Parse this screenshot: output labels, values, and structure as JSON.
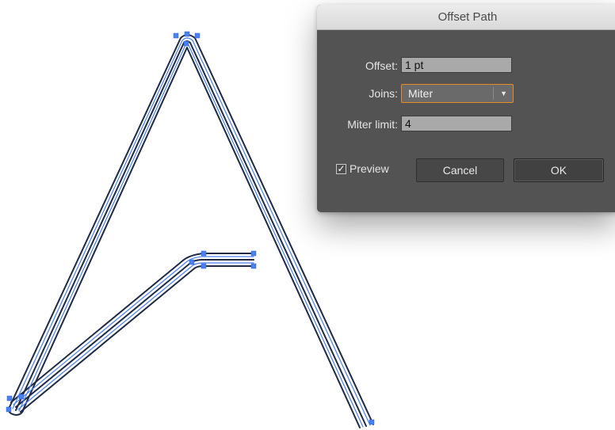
{
  "dialog": {
    "title": "Offset Path",
    "offset": {
      "label": "Offset:",
      "value": "1 pt"
    },
    "joins": {
      "label": "Joins:",
      "selected": "Miter",
      "arrow": "▼"
    },
    "miter_limit": {
      "label": "Miter limit:",
      "value": "4"
    },
    "preview": {
      "label": "Preview",
      "checked": true,
      "check_glyph": "✓"
    },
    "cancel_label": "Cancel",
    "ok_label": "OK"
  },
  "colors": {
    "dialog_bg": "#535353",
    "titlebar": "#dcdcdc",
    "focus_accent": "#e88a26",
    "path_dark": "#1f2a44",
    "path_blue": "#4a80f0"
  },
  "artwork": {
    "description_icon": "vector-path-letter-a"
  }
}
